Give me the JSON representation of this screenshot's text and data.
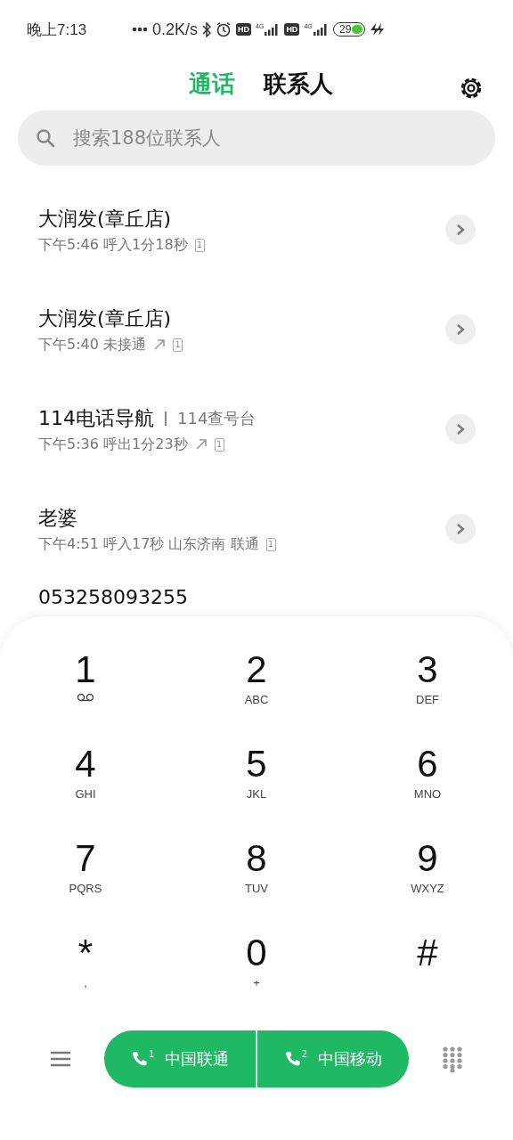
{
  "status_bar": {
    "time": "晚上7:13",
    "speed": "0.2K/s",
    "sims": [
      {
        "hd": "HD",
        "network": "4G"
      },
      {
        "hd": "HD",
        "network": "4G"
      }
    ],
    "battery": "29"
  },
  "tabs": [
    {
      "label": "通话",
      "selected": true
    },
    {
      "label": "联系人",
      "selected": false
    }
  ],
  "search": {
    "placeholder": "搜索188位联系人"
  },
  "calls": [
    {
      "name": "大润发(章丘店)",
      "time": "下午5:46",
      "detail": "呼入1分18秒",
      "outgoing": false,
      "sim": "1"
    },
    {
      "name": "大润发(章丘店)",
      "time": "下午5:40",
      "detail": "未接通",
      "outgoing": true,
      "sim": "1"
    },
    {
      "name": "114电话导航",
      "label": "114查号台",
      "time": "下午5:36",
      "detail": "呼出1分23秒",
      "outgoing": true,
      "sim": "1"
    },
    {
      "name": "老婆",
      "time": "下午4:51",
      "detail": "呼入17秒  山东济南 联通",
      "outgoing": false,
      "sim": "1"
    },
    {
      "name": "053258093255"
    }
  ],
  "keypad": [
    {
      "digit": "1",
      "kind": "voicemail"
    },
    {
      "digit": "2",
      "letters": "ABC",
      "kind": "letters"
    },
    {
      "digit": "3",
      "letters": "DEF",
      "kind": "letters"
    },
    {
      "digit": "4",
      "letters": "GHI",
      "kind": "letters"
    },
    {
      "digit": "5",
      "letters": "JKL",
      "kind": "letters"
    },
    {
      "digit": "6",
      "letters": "MNO",
      "kind": "letters"
    },
    {
      "digit": "7",
      "letters": "PQRS",
      "kind": "letters"
    },
    {
      "digit": "8",
      "letters": "TUV",
      "kind": "letters"
    },
    {
      "digit": "9",
      "letters": "WXYZ",
      "kind": "letters"
    },
    {
      "digit": "*",
      "letters": ",",
      "kind": "letters"
    },
    {
      "digit": "0",
      "letters": "+",
      "kind": "letters"
    },
    {
      "digit": "#",
      "kind": "plain"
    }
  ],
  "call_buttons": [
    {
      "sim": "1",
      "label": "中国联通"
    },
    {
      "sim": "2",
      "label": "中国移动"
    }
  ]
}
